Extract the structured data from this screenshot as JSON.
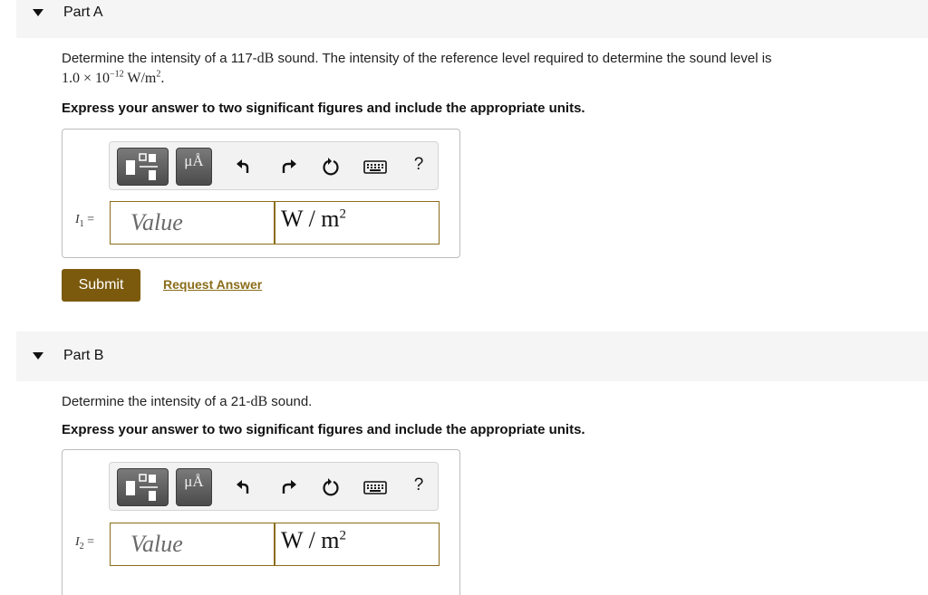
{
  "partA": {
    "title": "Part A",
    "q_pre": "Determine the intensity of a 117-",
    "q_unit": "dB",
    "q_post": " sound. The intensity of the reference level required to determine the sound level is",
    "ref_mantissa": "1.0 × 10",
    "ref_exp": "−12",
    "ref_unit": " W/m",
    "ref_unit_exp": "2",
    "ref_end": ".",
    "instruction": "Express your answer to two significant figures and include the appropriate units.",
    "var_symbol": "I",
    "var_sub": "1",
    "var_eq": " =",
    "value_placeholder": "Value",
    "unit_text": "W / m",
    "unit_exp": "2",
    "submit_label": "Submit",
    "request_label": "Request Answer"
  },
  "partB": {
    "title": "Part B",
    "q_pre": "Determine the intensity of a 21-",
    "q_unit": "dB",
    "q_post": " sound.",
    "instruction": "Express your answer to two significant figures and include the appropriate units.",
    "var_symbol": "I",
    "var_sub": "2",
    "var_eq": " =",
    "value_placeholder": "Value",
    "unit_text": "W / m",
    "unit_exp": "2"
  },
  "toolbar": {
    "templates_icon": "fraction-template-icon",
    "units_label": "μÅ",
    "undo_icon": "undo-icon",
    "redo_icon": "redo-icon",
    "reset_icon": "reset-icon",
    "keyboard_icon": "keyboard-icon",
    "help_label": "?"
  },
  "colors": {
    "header_bg": "#f5f5f5",
    "submit_bg": "#7b5a0d",
    "link": "#8a6d1a",
    "input_border": "#8a6d1a"
  }
}
